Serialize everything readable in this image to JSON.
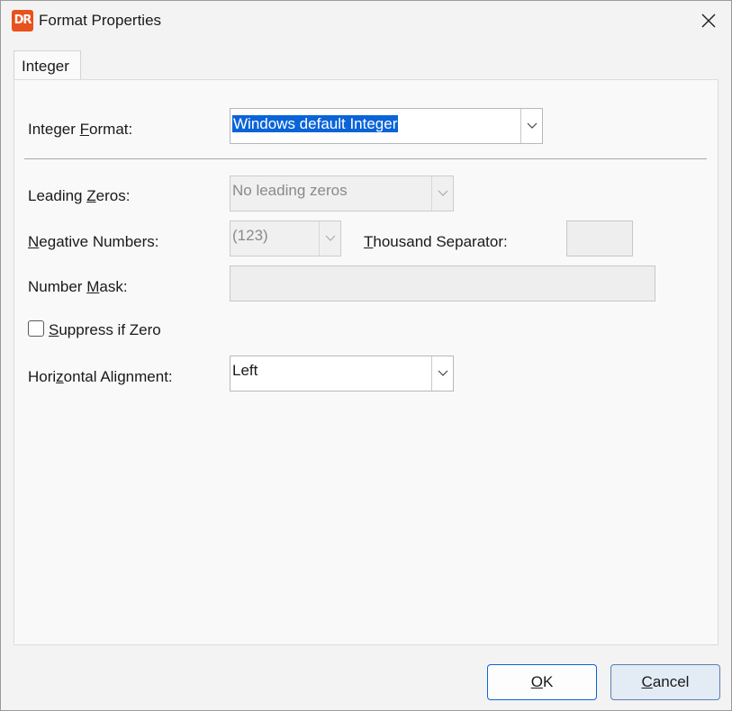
{
  "window": {
    "title": "Format Properties",
    "app_icon_text": "DR"
  },
  "tabs": [
    {
      "label": "Integer",
      "active": true
    }
  ],
  "integer_format": {
    "label_pre": "Integer ",
    "label_accel": "F",
    "label_post": "ormat:",
    "value": "Windows default Integer"
  },
  "leading_zeros": {
    "label_pre": "Leading ",
    "label_accel": "Z",
    "label_post": "eros:",
    "value": "No leading zeros"
  },
  "negative_numbers": {
    "label_pre": "",
    "label_accel": "N",
    "label_post": "egative Numbers:",
    "value": "(123)"
  },
  "thousand_separator": {
    "label_pre": "",
    "label_accel": "T",
    "label_post": "housand Separator:",
    "value": ""
  },
  "number_mask": {
    "label_pre": "Number ",
    "label_accel": "M",
    "label_post": "ask:",
    "value": ""
  },
  "suppress_if_zero": {
    "label_pre": "",
    "label_accel": "S",
    "label_post": "uppress if Zero",
    "checked": false
  },
  "horizontal_alignment": {
    "label_pre": "Hori",
    "label_accel": "z",
    "label_post": "ontal Alignment:",
    "value": "Left"
  },
  "buttons": {
    "ok": {
      "accel": "O",
      "rest": "K"
    },
    "cancel": {
      "accel": "C",
      "rest": "ancel"
    }
  },
  "colors": {
    "accent": "#0a64d8",
    "app_icon": "#e8521c"
  },
  "icons": [
    "app-logo-icon",
    "close-icon",
    "chevron-down-icon"
  ]
}
